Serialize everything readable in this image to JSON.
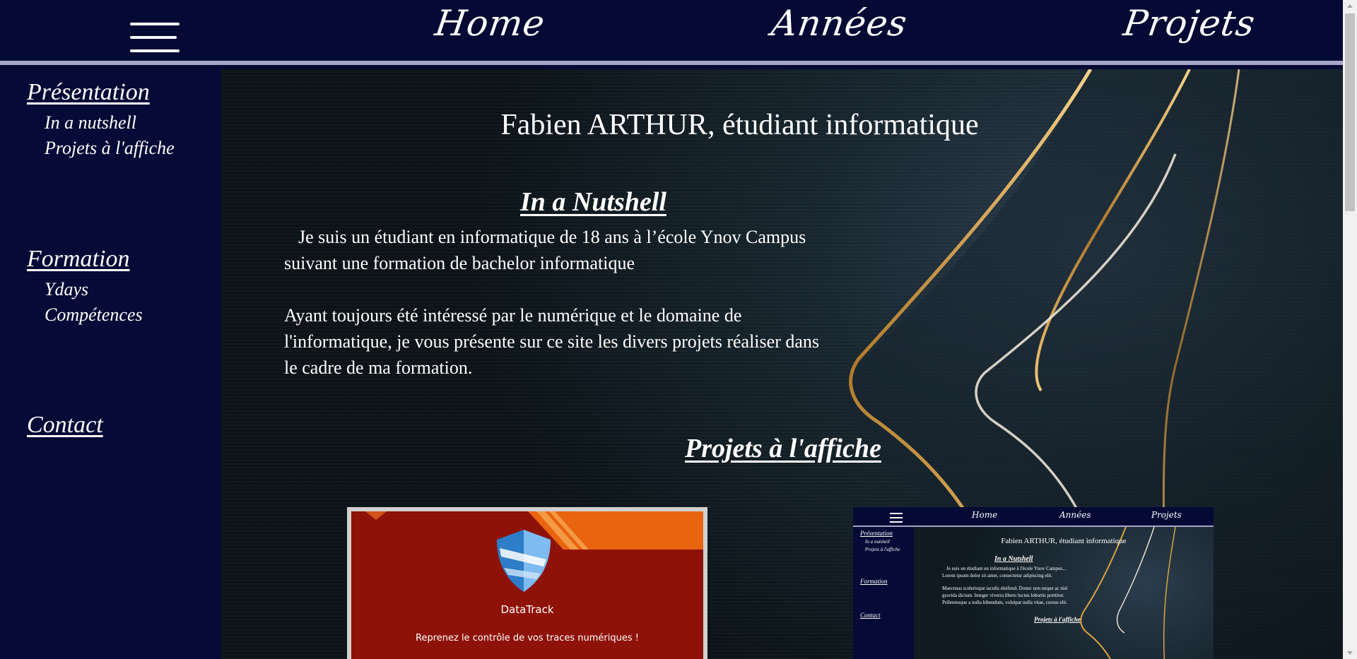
{
  "nav": {
    "links": [
      "Home",
      "Années",
      "Projets"
    ]
  },
  "sidebar": {
    "sections": [
      {
        "label": "Présentation",
        "items": [
          "In a nutshell",
          "Projets à l'affiche"
        ]
      },
      {
        "label": "Formation",
        "items": [
          "Ydays",
          "Compétences"
        ]
      },
      {
        "label": "Contact",
        "items": []
      }
    ]
  },
  "main": {
    "title": "Fabien ARTHUR, étudiant informatique",
    "nutshell": {
      "heading": "In a Nutshell",
      "para1_line1": "Je suis un étudiant en informatique de 18 ans à l’école Ynov Campus",
      "para1_line2": "suivant une formation de bachelor informatique",
      "para2_line1": "Ayant toujours été intéressé par le numérique et le domaine de",
      "para2_line2": "l'informatique, je vous présente sur ce site les divers projets réaliser dans",
      "para2_line3": "le cadre de ma formation."
    },
    "projects": {
      "heading": "Projets à l'affiche",
      "datatrack": {
        "name": "DataTrack",
        "tagline": "Reprenez le contrôle de vos traces numériques !"
      },
      "site_preview": {
        "nav": [
          "Home",
          "Années",
          "Projets"
        ],
        "side": [
          "Présentation",
          "In a nutshell",
          "Projets à l'affiche",
          "Formation",
          "Contact"
        ],
        "title": "Fabien ARTHUR, étudiant informatique",
        "heading": "In a Nutshell",
        "lines": [
          "Je suis un étudiant en informatique à l'école Ynov Campus...",
          "Lorem ipsum dolor sit amet, consectetur adipiscing elit.",
          "Maecenas scelerisque iaculis eleifend. Donec non neque ac nisl",
          "gravida dictum. Integer viverra libero luctus lobortis porttitor.",
          "Pellentesque a nulla bibendum, volutpat nulla vitae, cursus elit."
        ],
        "heading2": "Projets à l'affiche"
      }
    }
  },
  "colors": {
    "navy": "#050a35",
    "nav_border": "#a7a6c6",
    "datatrack_red": "#8f1208",
    "datatrack_orange": "#e8640f",
    "gold": "#d9a441"
  },
  "icons": [
    "hamburger-menu-icon",
    "shield-logo-icon"
  ]
}
